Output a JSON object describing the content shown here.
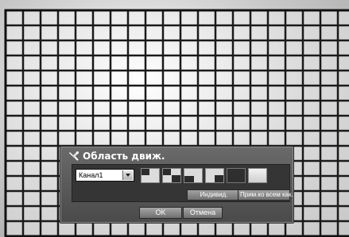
{
  "dialog": {
    "title": "Область движ.",
    "channel": {
      "value": "Канал1"
    },
    "buttons": {
      "individual": "Индивид.",
      "apply_all": "Прим.ко всем как."
    },
    "ok": "OK",
    "cancel": "Отмена"
  },
  "icons": {
    "title": "tool-icon",
    "dropdown": "chevron-down-icon"
  }
}
